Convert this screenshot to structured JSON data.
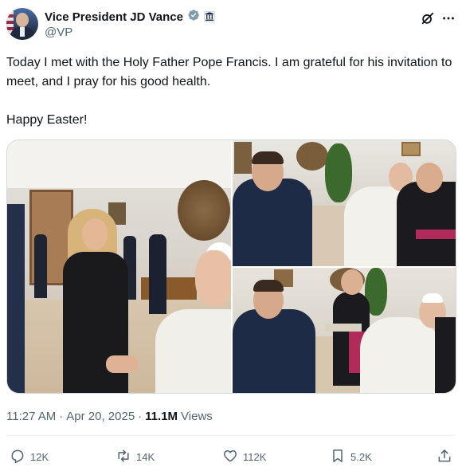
{
  "author": {
    "display_name": "Vice President JD Vance",
    "handle": "@VP"
  },
  "tweet": {
    "text": "Today I met with the Holy Father Pope Francis. I am grateful for his invitation to meet, and I pray for his good health.\n\nHappy Easter!"
  },
  "media": {
    "photo_count": 3
  },
  "meta": {
    "time": "11:27 AM",
    "separator": "·",
    "date": "Apr 20, 2025",
    "views_count": "11.1M",
    "views_label": "Views"
  },
  "actions": {
    "replies": "12K",
    "reposts": "14K",
    "likes": "112K",
    "bookmarks": "5.2K"
  },
  "colors": {
    "text_primary": "#0f1419",
    "text_secondary": "#536471",
    "verified_badge": "#829aab",
    "border": "#cfd9de"
  },
  "icons": {
    "verified": "verified-badge-icon",
    "affiliation": "government-building-icon",
    "grok": "grok-icon",
    "more": "more-icon",
    "reply": "reply-icon",
    "repost": "repost-icon",
    "like": "heart-icon",
    "bookmark": "bookmark-icon",
    "share": "share-icon"
  }
}
